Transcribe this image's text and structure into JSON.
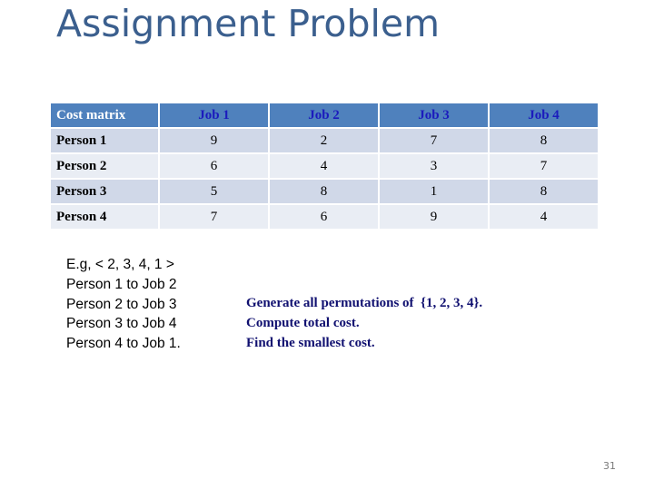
{
  "slide": {
    "title": "Assignment Problem",
    "page_number": "31"
  },
  "cost_matrix": {
    "corner_label": "Cost matrix",
    "columns": [
      "Job 1",
      "Job 2",
      "Job 3",
      "Job 4"
    ],
    "rows": [
      {
        "label": "Person 1",
        "values": [
          "9",
          "2",
          "7",
          "8"
        ]
      },
      {
        "label": "Person 2",
        "values": [
          "6",
          "4",
          "3",
          "7"
        ]
      },
      {
        "label": "Person 3",
        "values": [
          "5",
          "8",
          "1",
          "8"
        ]
      },
      {
        "label": "Person 4",
        "values": [
          "7",
          "6",
          "9",
          "4"
        ]
      }
    ]
  },
  "example": {
    "lines": [
      "E.g, < 2, 3, 4, 1 >",
      "Person 1 to Job 2",
      "Person 2 to Job 3",
      "Person 3 to Job 4",
      "Person 4 to Job 1."
    ]
  },
  "steps": {
    "lines": [
      "Generate all permutations of  {1, 2, 3, 4}.",
      "Compute total cost.",
      "Find the smallest cost."
    ]
  },
  "colors": {
    "title": "#3b5f8e",
    "header_bg": "#4f81bd",
    "header_text": "#1b1bbd",
    "row_odd_bg": "#d0d8e8",
    "row_even_bg": "#e9edf4",
    "steps_text": "#101070"
  }
}
